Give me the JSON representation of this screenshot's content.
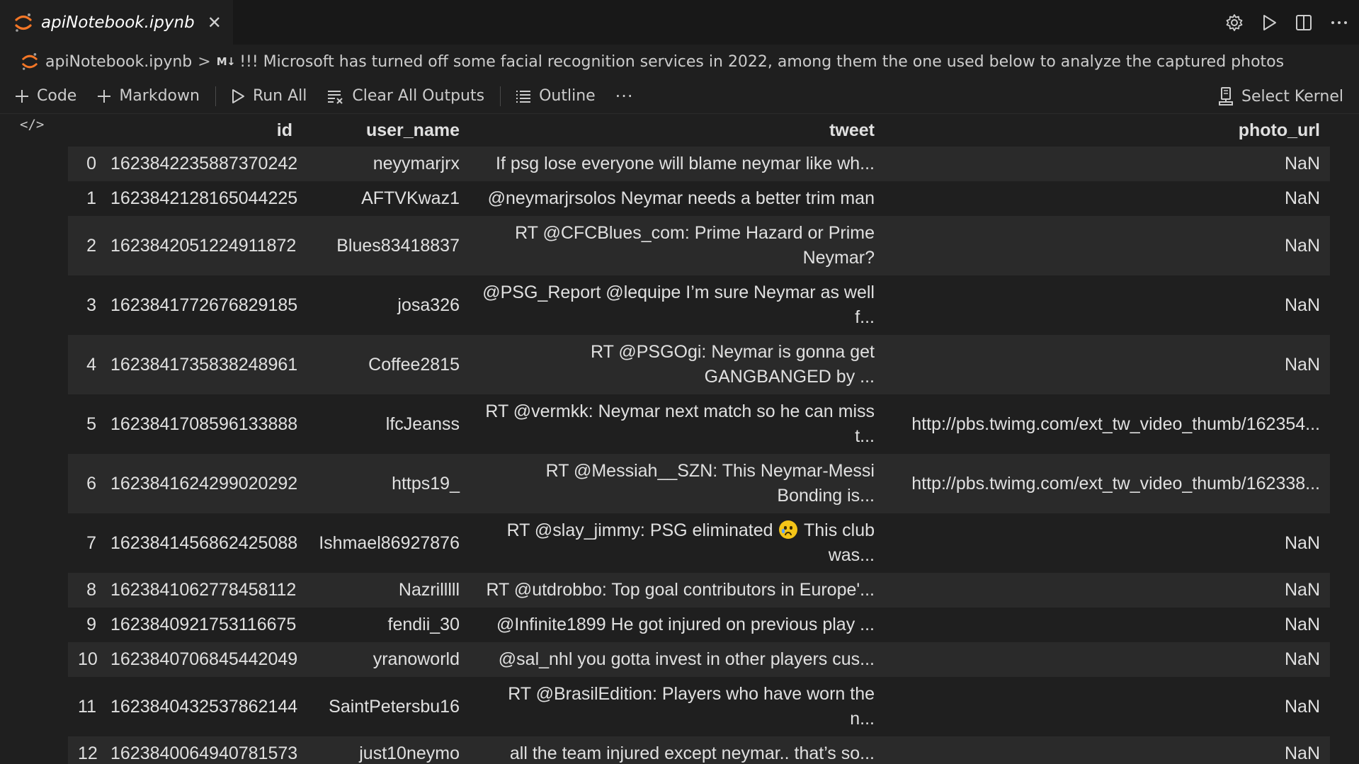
{
  "tab": {
    "title": "apiNotebook.ipynb",
    "close": "✕"
  },
  "breadcrumb": {
    "file": "apiNotebook.ipynb",
    "separator": ">",
    "md_badge": "M↓",
    "cell_text": "!!! Microsoft has turned off some facial recognition services in 2022, among them the one used below to analyze the captured photos"
  },
  "toolbar": {
    "code": "Code",
    "markdown": "Markdown",
    "run_all": "Run All",
    "clear_all": "Clear All Outputs",
    "outline": "Outline",
    "more": "···",
    "kernel": "Select Kernel"
  },
  "cell": {
    "gutter_icon": "</>"
  },
  "table": {
    "columns": [
      "",
      "id",
      "user_name",
      "tweet",
      "photo_url"
    ],
    "rows": [
      {
        "idx": "0",
        "id": "1623842235887370242",
        "user": "neyymarjrx",
        "tweet": "If psg lose everyone will blame neymar like wh...",
        "photo": "NaN"
      },
      {
        "idx": "1",
        "id": "1623842128165044225",
        "user": "AFTVKwaz1",
        "tweet": "@neymarjrsolos Neymar needs a better trim man",
        "photo": "NaN"
      },
      {
        "idx": "2",
        "id": "1623842051224911872",
        "user": "Blues83418837",
        "tweet": "RT @CFCBlues_com: Prime Hazard or Prime Neymar?",
        "photo": "NaN"
      },
      {
        "idx": "3",
        "id": "1623841772676829185",
        "user": "josa326",
        "tweet": "@PSG_Report @lequipe I’m sure Neymar as well f...",
        "photo": "NaN"
      },
      {
        "idx": "4",
        "id": "1623841735838248961",
        "user": "Coffee2815",
        "tweet": "RT @PSGOgi: Neymar is gonna get GANGBANGED by ...",
        "photo": "NaN"
      },
      {
        "idx": "5",
        "id": "1623841708596133888",
        "user": "lfcJeanss",
        "tweet": "RT @vermkk: Neymar next match so he can miss t...",
        "photo": "http://pbs.twimg.com/ext_tw_video_thumb/162354..."
      },
      {
        "idx": "6",
        "id": "1623841624299020292",
        "user": "https19_",
        "tweet": "RT @Messiah__SZN: This Neymar-Messi Bonding is...",
        "photo": "http://pbs.twimg.com/ext_tw_video_thumb/162338..."
      },
      {
        "idx": "7",
        "id": "1623841456862425088",
        "user": "Ishmael86927876",
        "tweet_pre": "RT @slay_jimmy: PSG eliminated ",
        "tweet_post": " This club was...",
        "photo": "NaN"
      },
      {
        "idx": "8",
        "id": "1623841062778458112",
        "user": "Nazrilllll",
        "tweet": "RT @utdrobbo: Top goal contributors in Europe'...",
        "photo": "NaN"
      },
      {
        "idx": "9",
        "id": "1623840921753116675",
        "user": "fendii_30",
        "tweet": "@Infinite1899 He got injured on previous play ...",
        "photo": "NaN"
      },
      {
        "idx": "10",
        "id": "1623840706845442049",
        "user": "yranoworld",
        "tweet": "@sal_nhl you gotta invest in other players cus...",
        "photo": "NaN"
      },
      {
        "idx": "11",
        "id": "1623840432537862144",
        "user": "SaintPetersbu16",
        "tweet": "RT @BrasilEdition: Players who have worn the n...",
        "photo": "NaN"
      },
      {
        "idx": "12",
        "id": "1623840064940781573",
        "user": "just10neymo",
        "tweet": "all the team injured except neymar.. that’s so...",
        "photo": "NaN"
      }
    ]
  },
  "colors": {
    "accent_jupyter": "#f37626",
    "background": "#1f1f1f",
    "row_alt": "#2a2a2a"
  }
}
